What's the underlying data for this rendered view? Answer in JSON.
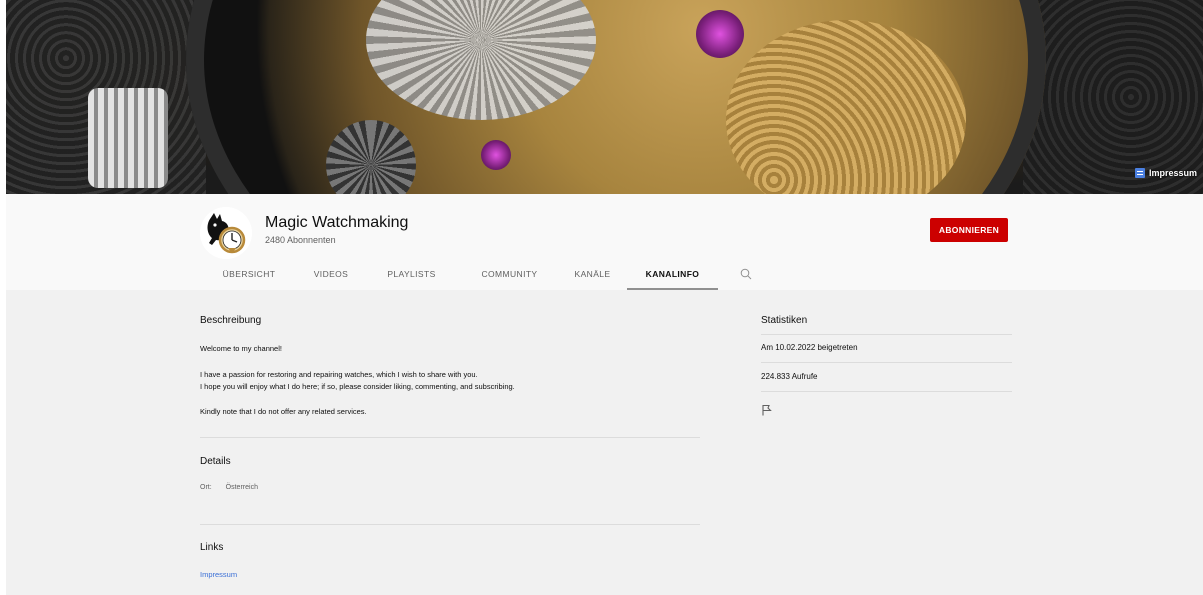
{
  "banner": {
    "link_label": "Impressum",
    "link_icon": "document-icon"
  },
  "channel": {
    "name": "Magic Watchmaking",
    "subscribers": "2480 Abonnenten",
    "subscribe_label": "ABONNIEREN",
    "subscribe_color": "#cc0000"
  },
  "tabs": [
    {
      "label": "ÜBERSICHT",
      "active": false
    },
    {
      "label": "VIDEOS",
      "active": false
    },
    {
      "label": "PLAYLISTS",
      "active": false
    },
    {
      "label": "COMMUNITY",
      "active": false
    },
    {
      "label": "KANÄLE",
      "active": false
    },
    {
      "label": "KANALINFO",
      "active": true
    }
  ],
  "search_icon": "search-icon",
  "about": {
    "description_title": "Beschreibung",
    "description": [
      "Welcome to my channel!",
      "I have a passion for restoring and repairing watches, which I wish to share with you.",
      "I hope you will enjoy what I do here; if so, please consider liking, commenting, and subscribing.",
      "Kindly note that I do not offer any related services."
    ],
    "details_title": "Details",
    "location_label": "Ort:",
    "location_value": "Österreich",
    "links_title": "Links",
    "link_label": "Impressum"
  },
  "stats": {
    "title": "Statistiken",
    "joined": "Am 10.02.2022 beigetreten",
    "views": "224.833 Aufrufe",
    "report_icon": "flag-icon"
  }
}
